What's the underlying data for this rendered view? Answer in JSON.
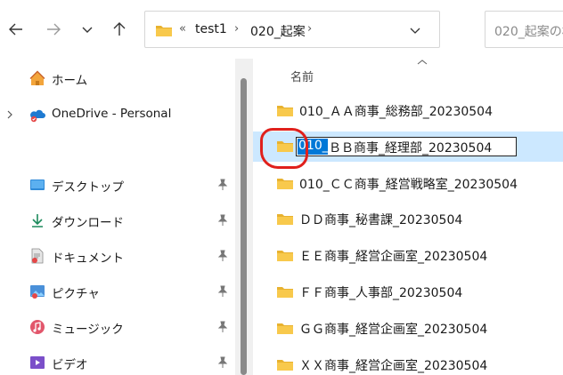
{
  "nav": {
    "back_icon": "arrow-left-icon",
    "forward_icon": "arrow-right-icon",
    "recent_icon": "chevron-down-icon",
    "up_icon": "arrow-up-icon"
  },
  "address": {
    "overflow": "«",
    "crumbs": [
      "test1",
      "020_起案"
    ],
    "separator": "›"
  },
  "search": {
    "placeholder": "020_起案の検"
  },
  "sidebar": {
    "items": [
      {
        "label": "ホーム",
        "icon": "home-icon"
      },
      {
        "label": "OneDrive - Personal",
        "icon": "onedrive-icon"
      },
      {
        "label": "デスクトップ",
        "icon": "desktop-icon"
      },
      {
        "label": "ダウンロード",
        "icon": "download-icon"
      },
      {
        "label": "ドキュメント",
        "icon": "documents-icon"
      },
      {
        "label": "ピクチャ",
        "icon": "pictures-icon"
      },
      {
        "label": "ミュージック",
        "icon": "music-icon"
      },
      {
        "label": "ビデオ",
        "icon": "videos-icon"
      }
    ]
  },
  "list": {
    "column_name": "名前",
    "rename": {
      "selected": "010_",
      "rest": "ＢＢ商事_経理部_20230504"
    },
    "rows": [
      "010_ＡＡ商事_総務部_20230504",
      "010_ＢＢ商事_経理部_20230504",
      "010_ＣＣ商事_経営戦略室_20230504",
      "ＤＤ商事_秘書課_20230504",
      "ＥＥ商事_経営企画室_20230504",
      "ＦＦ商事_人事部_20230504",
      "ＧＧ商事_経営企画室_20230504",
      "ＸＸ商事_経営企画室_20230504"
    ]
  },
  "colors": {
    "folder": "#f8c94c",
    "selection": "#cce8ff",
    "text_highlight": "#0078d7",
    "annotation": "#e0201c"
  }
}
